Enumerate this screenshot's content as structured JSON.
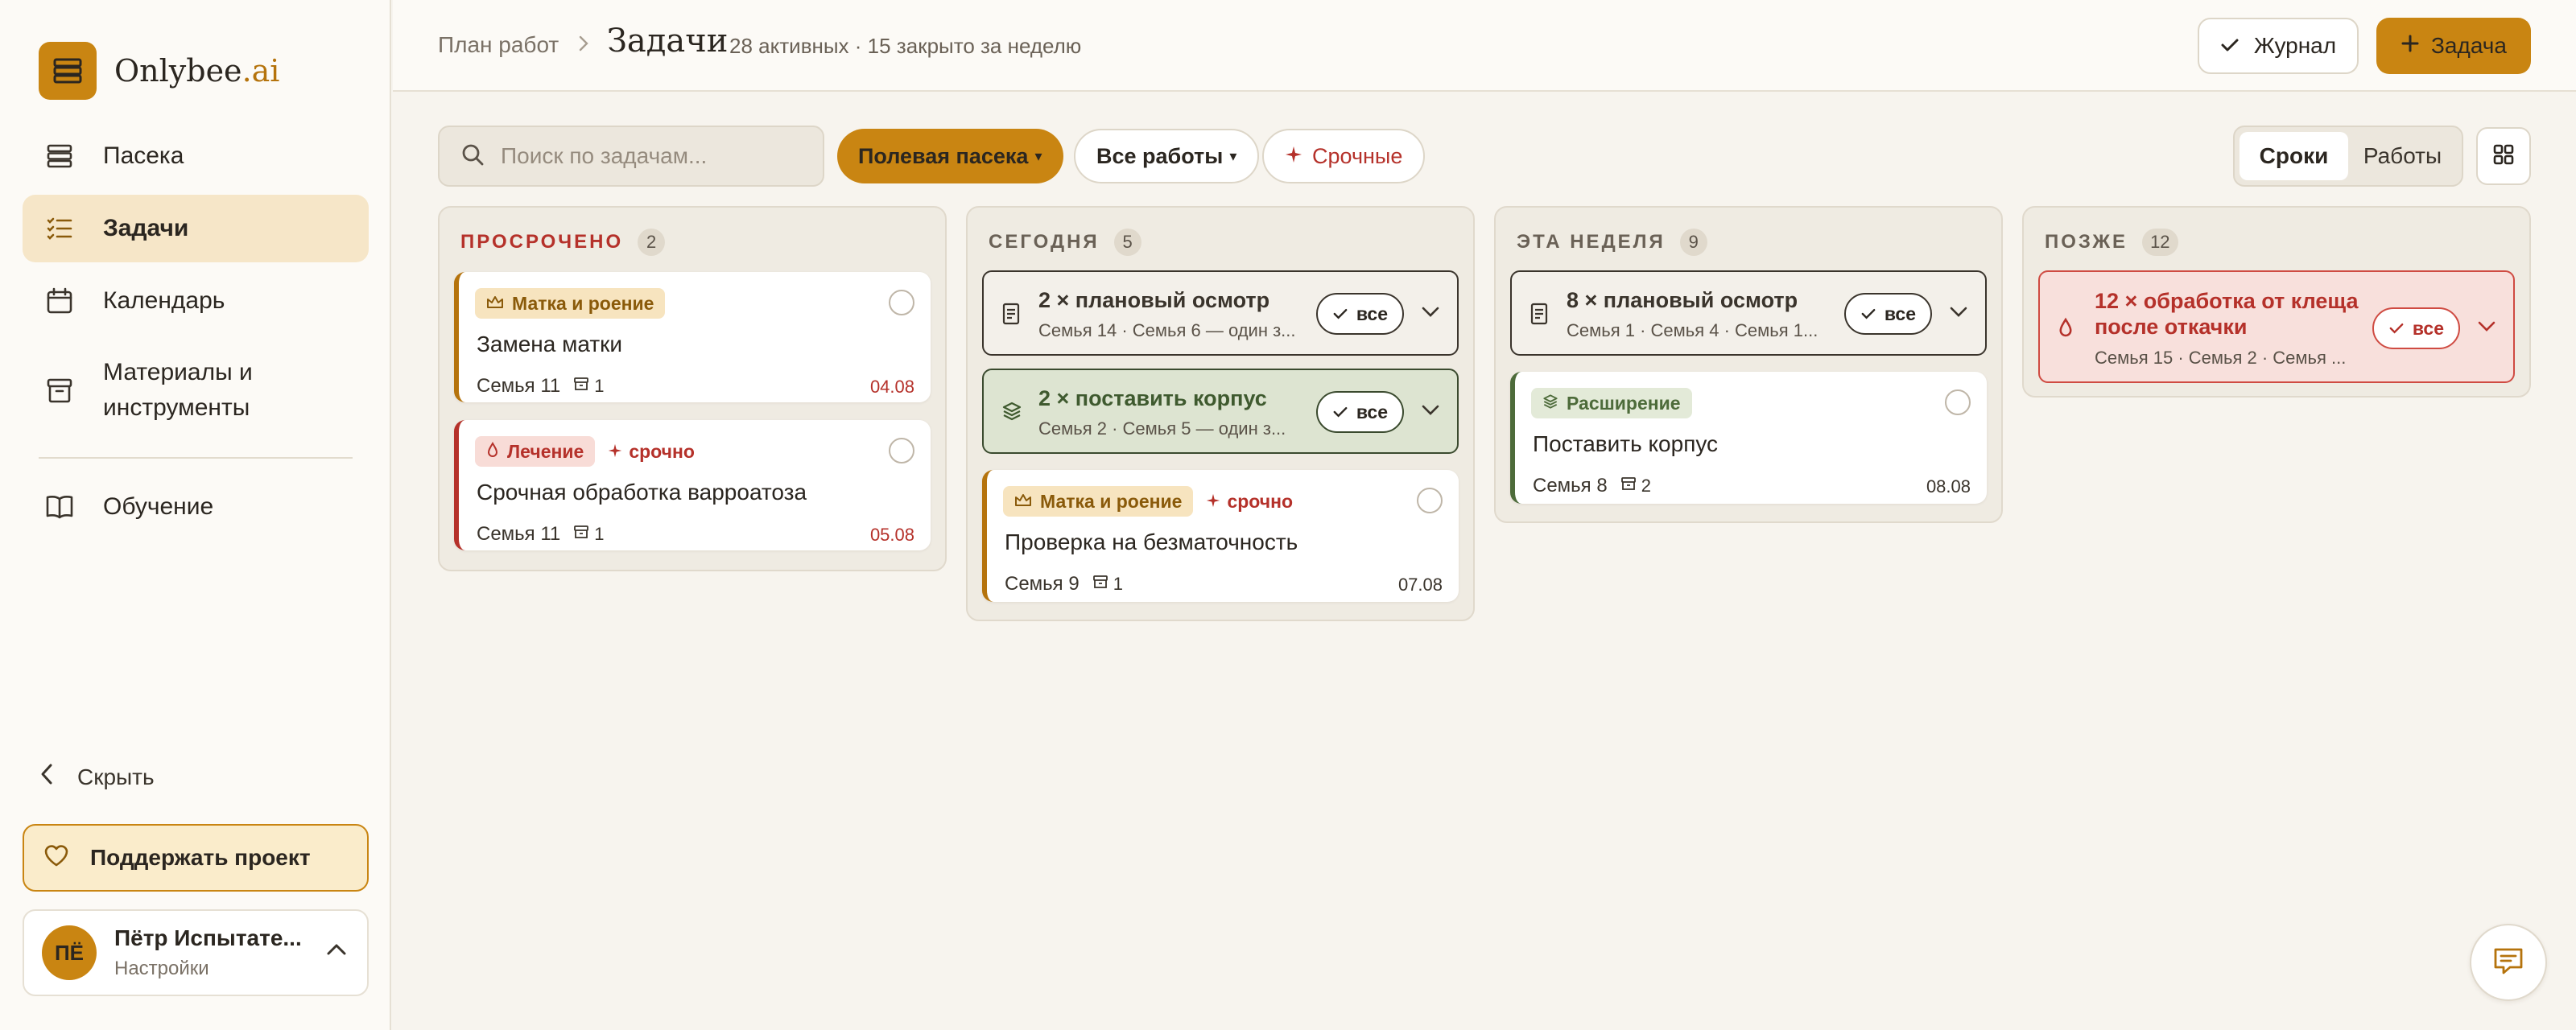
{
  "brand": {
    "name": "Onlybee",
    "suffix": ".ai"
  },
  "sidebar": {
    "items": [
      {
        "label": "Пасека",
        "icon": "stack-icon"
      },
      {
        "label": "Задачи",
        "icon": "list-check-icon",
        "active": true
      },
      {
        "label": "Календарь",
        "icon": "calendar-icon"
      },
      {
        "label": "Материалы и инструменты",
        "icon": "archive-icon"
      },
      {
        "label": "Обучение",
        "icon": "book-icon"
      }
    ],
    "hide_label": "Скрыть",
    "support_label": "Поддержать проект",
    "user": {
      "initials": "ПЁ",
      "name": "Пётр Испытате...",
      "sub": "Настройки"
    }
  },
  "header": {
    "breadcrumb": "План работ",
    "title": "Задачи",
    "subtitle": "28 активных · 15 закрыто за неделю",
    "journal_label": "Журнал",
    "task_label": "Задача"
  },
  "toolbar": {
    "search_placeholder": "Поиск по задачам...",
    "apiary_filter": "Полевая пасека",
    "works_filter": "Все работы",
    "urgent_filter": "Срочные",
    "view_options": [
      "Сроки",
      "Работы"
    ]
  },
  "columns": [
    {
      "title": "ПРОСРОЧЕНО",
      "count": "2",
      "cards": [
        {
          "tag": "Матка и роение",
          "urgent": "",
          "title": "Замена матки",
          "family": "Семья 11",
          "hives": "1",
          "date": "04.08"
        },
        {
          "tag": "Лечение",
          "urgent": "срочно",
          "title": "Срочная обработка варроатоза",
          "family": "Семья 11",
          "hives": "1",
          "date": "05.08"
        }
      ]
    },
    {
      "title": "СЕГОДНЯ",
      "count": "5",
      "groups": [
        {
          "title": "2 × плановый осмотр",
          "sub": "Семья 14 · Семья 6 — один з...",
          "all": "все"
        },
        {
          "title": "2 × поставить корпус",
          "sub": "Семья 2 · Семья 5 — один з...",
          "all": "все"
        }
      ],
      "cards": [
        {
          "tag": "Матка и роение",
          "urgent": "срочно",
          "title": "Проверка на безматочность",
          "family": "Семья 9",
          "hives": "1",
          "date": "07.08"
        }
      ]
    },
    {
      "title": "ЭТА НЕДЕЛЯ",
      "count": "9",
      "groups": [
        {
          "title": "8 × плановый осмотр",
          "sub": "Семья 1 · Семья 4 · Семья 1...",
          "all": "все"
        }
      ],
      "cards": [
        {
          "tag": "Расширение",
          "urgent": "",
          "title": "Поставить корпус",
          "family": "Семья 8",
          "hives": "2",
          "date": "08.08"
        }
      ]
    },
    {
      "title": "ПОЗЖЕ",
      "count": "12",
      "groups": [
        {
          "title": "12 × обработка от клеща после откачки",
          "sub": "Семья 15 · Семья 2 · Семья ...",
          "all": "все"
        }
      ]
    }
  ],
  "colors": {
    "accent": "#c98512",
    "danger": "#b5312a",
    "success": "#4d6b3a"
  }
}
